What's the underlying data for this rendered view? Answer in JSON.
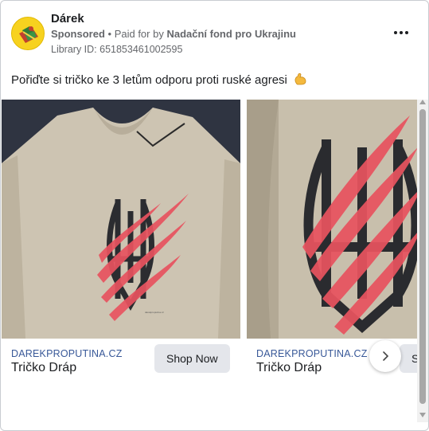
{
  "header": {
    "page_name": "Dárek",
    "sponsored": "Sponsored",
    "separator": " • ",
    "paid_for_by_prefix": "Paid for by ",
    "funder": "Nadační fond pro Ukrajinu",
    "library_id": "Library ID: 651853461002595",
    "more_icon": "more-horizontal-icon"
  },
  "ad_text": "Pořiďte si tričko ke 3 letům odporu proti ruské agresi",
  "ad_emoji": "flexed-biceps-emoji",
  "carousel": {
    "slides": [
      {
        "domain": "DAREKPROPUTINA.CZ",
        "title": "Tričko Dráp",
        "cta": "Shop Now"
      },
      {
        "domain": "DAREKPROPUTINA.CZ",
        "title": "Tričko Dráp",
        "cta": "Shop Now"
      }
    ],
    "next_icon": "chevron-right-icon"
  },
  "colors": {
    "link_blue": "#385898",
    "shirt": "#cfc6b4",
    "claw_red": "#e8535f",
    "trident": "#26272b",
    "avatar_yellow": "#f7d21f"
  }
}
